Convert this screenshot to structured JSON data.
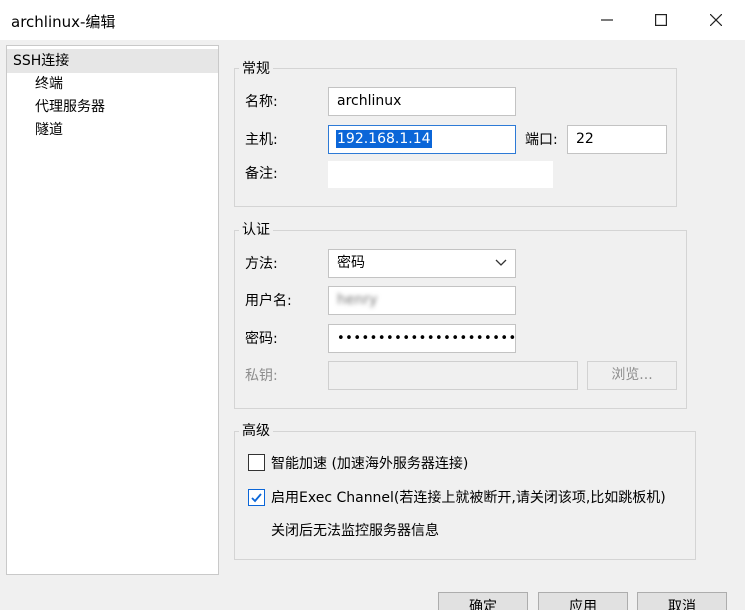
{
  "window": {
    "title": "archlinux-编辑",
    "minimize_icon": "minimize-icon",
    "maximize_icon": "maximize-icon",
    "close_icon": "close-icon"
  },
  "sidebar": {
    "items": [
      {
        "label": "SSH连接",
        "selected": true
      },
      {
        "label": "终端"
      },
      {
        "label": "代理服务器"
      },
      {
        "label": "隧道"
      }
    ]
  },
  "general": {
    "legend": "常规",
    "name_label": "名称:",
    "name_value": "archlinux",
    "host_label": "主机:",
    "host_value": "192.168.1.14",
    "port_label": "端口:",
    "port_value": "22",
    "note_label": "备注:",
    "note_value": ""
  },
  "auth": {
    "legend": "认证",
    "method_label": "方法:",
    "method_value": "密码",
    "user_label": "用户名:",
    "user_value": "henry",
    "password_label": "密码:",
    "password_value": "••••••••••••••••••••••",
    "key_label": "私钥:",
    "key_value": "",
    "browse_label": "浏览..."
  },
  "advanced": {
    "legend": "高级",
    "smart_accel_label": "智能加速 (加速海外服务器连接)",
    "smart_accel_checked": false,
    "exec_channel_label": "启用Exec Channel(若连接上就被断开,请关闭该项,比如跳板机)",
    "exec_channel_checked": true,
    "exec_channel_note": "关闭后无法监控服务器信息"
  },
  "footer": {
    "ok_label": "确定",
    "apply_label": "应用",
    "cancel_label": "取消"
  },
  "colors": {
    "accent": "#0b66d8",
    "focus_border": "#2d7ad6"
  }
}
